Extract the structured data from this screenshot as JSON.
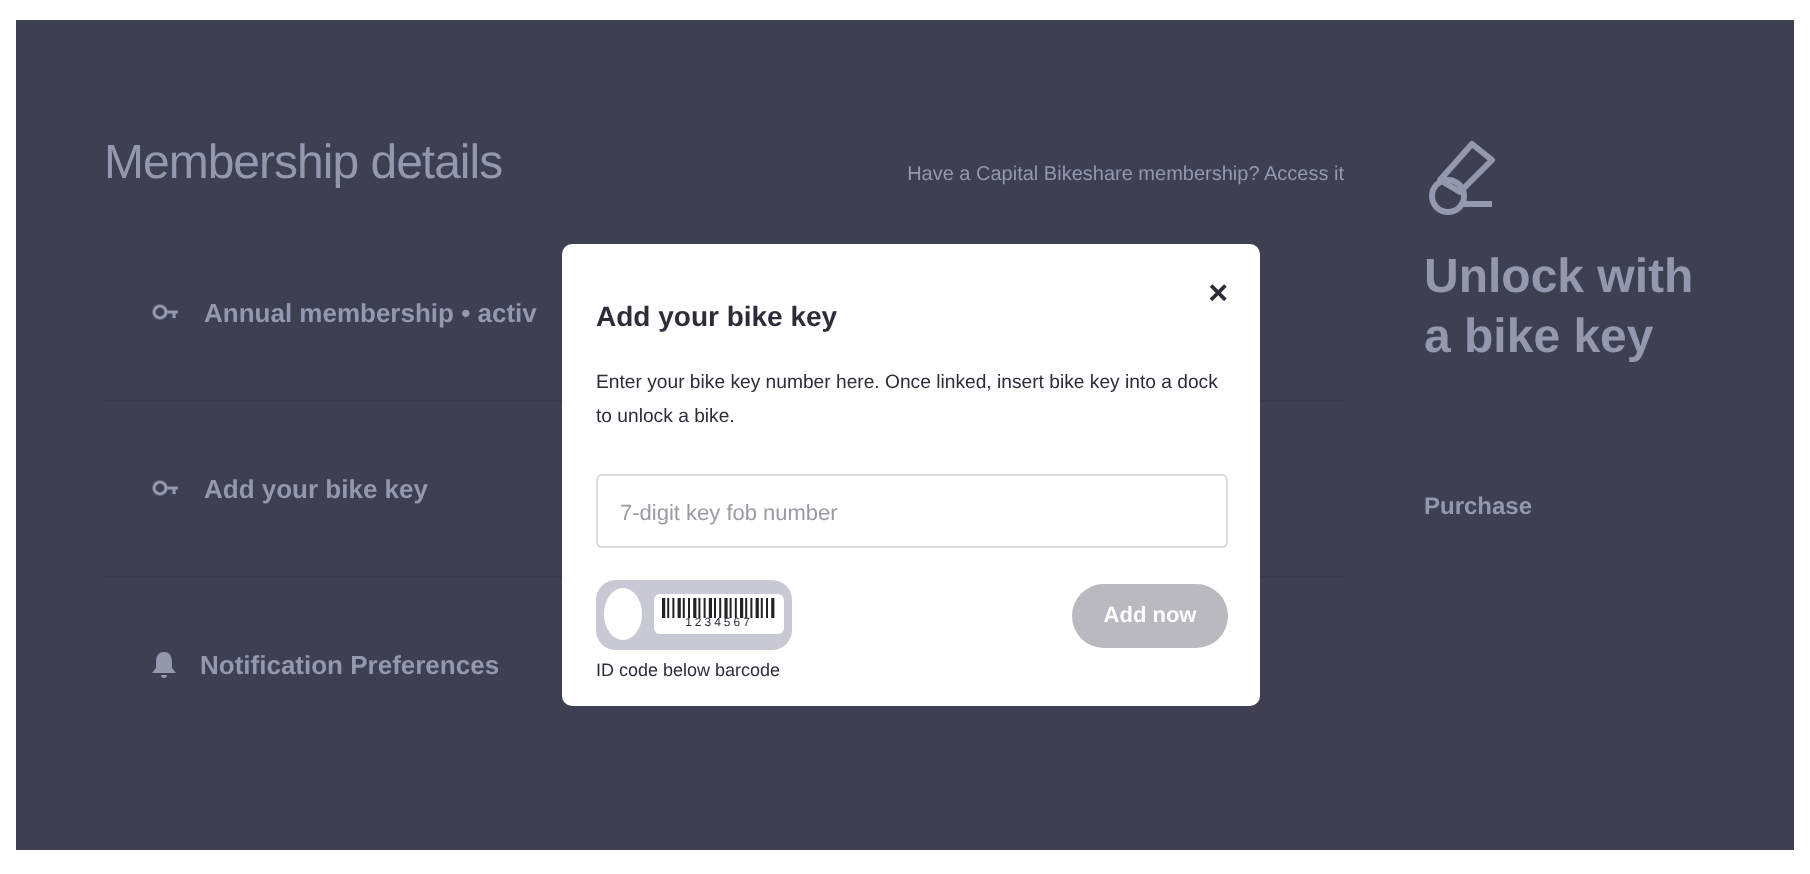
{
  "page": {
    "heading": "Membership details",
    "membership_link": "Have a Capital Bikeshare membership? Access it",
    "items": [
      {
        "kind": "key",
        "title": "Annual membership • activ"
      },
      {
        "kind": "key",
        "title": "Add your bike key"
      },
      {
        "kind": "bell",
        "title": "Notification Preferences"
      }
    ]
  },
  "promo": {
    "title": "Unlock with a bike key",
    "link": "Purchase"
  },
  "modal": {
    "title": "Add your bike key",
    "close": "×",
    "description": "Enter your bike key number here. Once linked, insert bike key into a dock to unlock a bike.",
    "input": {
      "placeholder": "7-digit key fob number"
    },
    "key_fob": {
      "number": "1234567",
      "caption": "ID code below barcode"
    },
    "button": {
      "label": "Add now",
      "disabled": true
    }
  }
}
